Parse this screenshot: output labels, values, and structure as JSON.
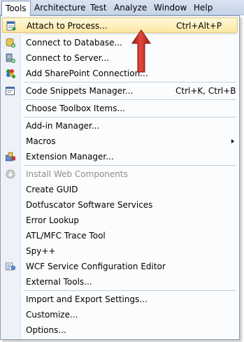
{
  "menubar": {
    "items": [
      {
        "label": "Tools"
      },
      {
        "label": "Architecture"
      },
      {
        "label": "Test"
      },
      {
        "label": "Analyze"
      },
      {
        "label": "Window"
      },
      {
        "label": "Help"
      }
    ]
  },
  "menu": {
    "items": [
      {
        "label": "Attach to Process...",
        "shortcut": "Ctrl+Alt+P",
        "icon": "attach-process-icon",
        "highlighted": true
      },
      {
        "label": "Connect to Database...",
        "icon": "database-icon"
      },
      {
        "label": "Connect to Server...",
        "icon": "server-icon"
      },
      {
        "label": "Add SharePoint Connection...",
        "icon": "sharepoint-icon"
      },
      {
        "label": "Code Snippets Manager...",
        "shortcut": "Ctrl+K, Ctrl+B",
        "icon": "snippets-icon"
      },
      {
        "label": "Choose Toolbox Items..."
      },
      {
        "label": "Add-in Manager..."
      },
      {
        "label": "Macros",
        "has_submenu": true
      },
      {
        "label": "Extension Manager...",
        "icon": "extension-icon"
      },
      {
        "label": "Install Web Components",
        "icon": "install-icon",
        "disabled": true
      },
      {
        "label": "Create GUID"
      },
      {
        "label": "Dotfuscator Software Services"
      },
      {
        "label": "Error Lookup"
      },
      {
        "label": "ATL/MFC Trace Tool"
      },
      {
        "label": "Spy++"
      },
      {
        "label": "WCF Service Configuration Editor",
        "icon": "wcf-icon"
      },
      {
        "label": "External Tools..."
      },
      {
        "label": "Import and Export Settings..."
      },
      {
        "label": "Customize..."
      },
      {
        "label": "Options..."
      }
    ]
  },
  "colors": {
    "highlight_border": "#e5c365",
    "annotation_arrow": "#c8281d"
  }
}
